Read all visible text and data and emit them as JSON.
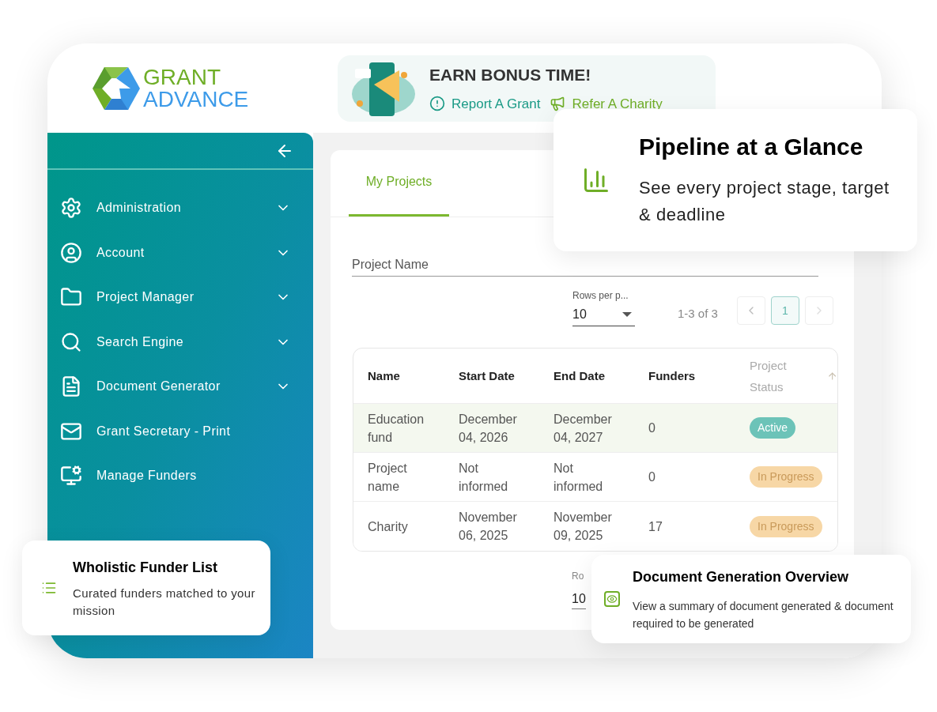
{
  "logo": {
    "line_1": "GRANT",
    "line_2": "ADVANCE"
  },
  "bonus_banner": {
    "title": "EARN BONUS TIME!",
    "links": [
      "Report A Grant",
      "Refer A Charity"
    ]
  },
  "sidebar": {
    "items": [
      {
        "label": "Administration",
        "has_submenu": true
      },
      {
        "label": "Account",
        "has_submenu": true
      },
      {
        "label": "Project Manager",
        "has_submenu": true
      },
      {
        "label": "Search Engine",
        "has_submenu": true
      },
      {
        "label": "Document Generator",
        "has_submenu": true
      },
      {
        "label": "Grant Secretary - Print",
        "has_submenu": false
      },
      {
        "label": "Manage Funders",
        "has_submenu": false
      }
    ]
  },
  "tabs": [
    {
      "label": "My Projects",
      "selected": true
    }
  ],
  "search": {
    "placeholder": "Project Name"
  },
  "pagination": {
    "rows_label": "Rows per p...",
    "rows_value": "10",
    "range": "1-3 of 3",
    "pages": [
      {
        "label": "1",
        "selected": true
      }
    ]
  },
  "table": {
    "columns": [
      {
        "label": "Name",
        "sorted": false
      },
      {
        "label": "Start Date",
        "sorted": false
      },
      {
        "label": "End Date",
        "sorted": false
      },
      {
        "label": "Funders",
        "sorted": false
      },
      {
        "label": "Project Status",
        "sorted": true
      }
    ],
    "rows": [
      {
        "selected": true,
        "cells": [
          "Education fund",
          "December 04, 2026",
          "December 04, 2027",
          "0"
        ],
        "status": {
          "label": "Active",
          "kind": "active"
        }
      },
      {
        "selected": false,
        "cells": [
          "Project name",
          "Not informed",
          "Not informed",
          "0"
        ],
        "status": {
          "label": "In Progress",
          "kind": "progress"
        }
      },
      {
        "selected": false,
        "cells": [
          "Charity",
          "November 06, 2025",
          "November 09, 2025",
          "17"
        ],
        "status": {
          "label": "In Progress",
          "kind": "progress"
        }
      }
    ]
  },
  "bottom_pagination": {
    "label": "Ro",
    "value": "10"
  },
  "feature_cards": [
    {
      "kind": "list",
      "title": "Wholistic Funder List",
      "text": "Curated funders matched to your mission"
    },
    {
      "kind": "chart",
      "title": "Pipeline at a Glance",
      "text": "See every project stage, target & deadline"
    },
    {
      "kind": "document",
      "title": "Document Generation Overview",
      "text": "View a summary of document generated & document required to be generated"
    }
  ]
}
